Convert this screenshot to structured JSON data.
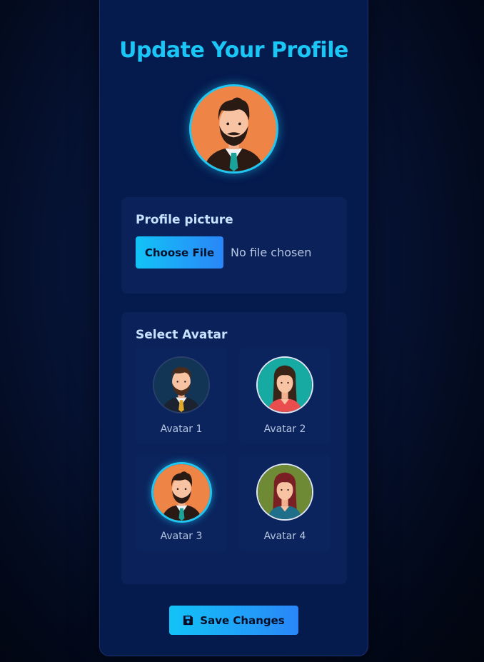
{
  "page": {
    "title": "Update Your Profile"
  },
  "profile": {
    "current_avatar_icon": "bearded-man-avatar-icon"
  },
  "file_section": {
    "label": "Profile picture",
    "button_label": "Choose File",
    "status": "No file chosen"
  },
  "avatar_section": {
    "label": "Select Avatar",
    "options": [
      {
        "label": "Avatar 1",
        "icon": "man-beard-navy-avatar-icon",
        "selected": false
      },
      {
        "label": "Avatar 2",
        "icon": "woman-teal-avatar-icon",
        "selected": false
      },
      {
        "label": "Avatar 3",
        "icon": "man-beard-orange-avatar-icon",
        "selected": true
      },
      {
        "label": "Avatar 4",
        "icon": "woman-green-avatar-icon",
        "selected": false
      }
    ]
  },
  "actions": {
    "save_label": "Save Changes",
    "save_icon": "floppy-disk-icon"
  },
  "colors": {
    "accent": "#19c6f5",
    "button_gradient_start": "#12c3f7",
    "button_gradient_end": "#2a86f8",
    "card_bg": "#051a4d",
    "section_bg": "#0a2159"
  }
}
